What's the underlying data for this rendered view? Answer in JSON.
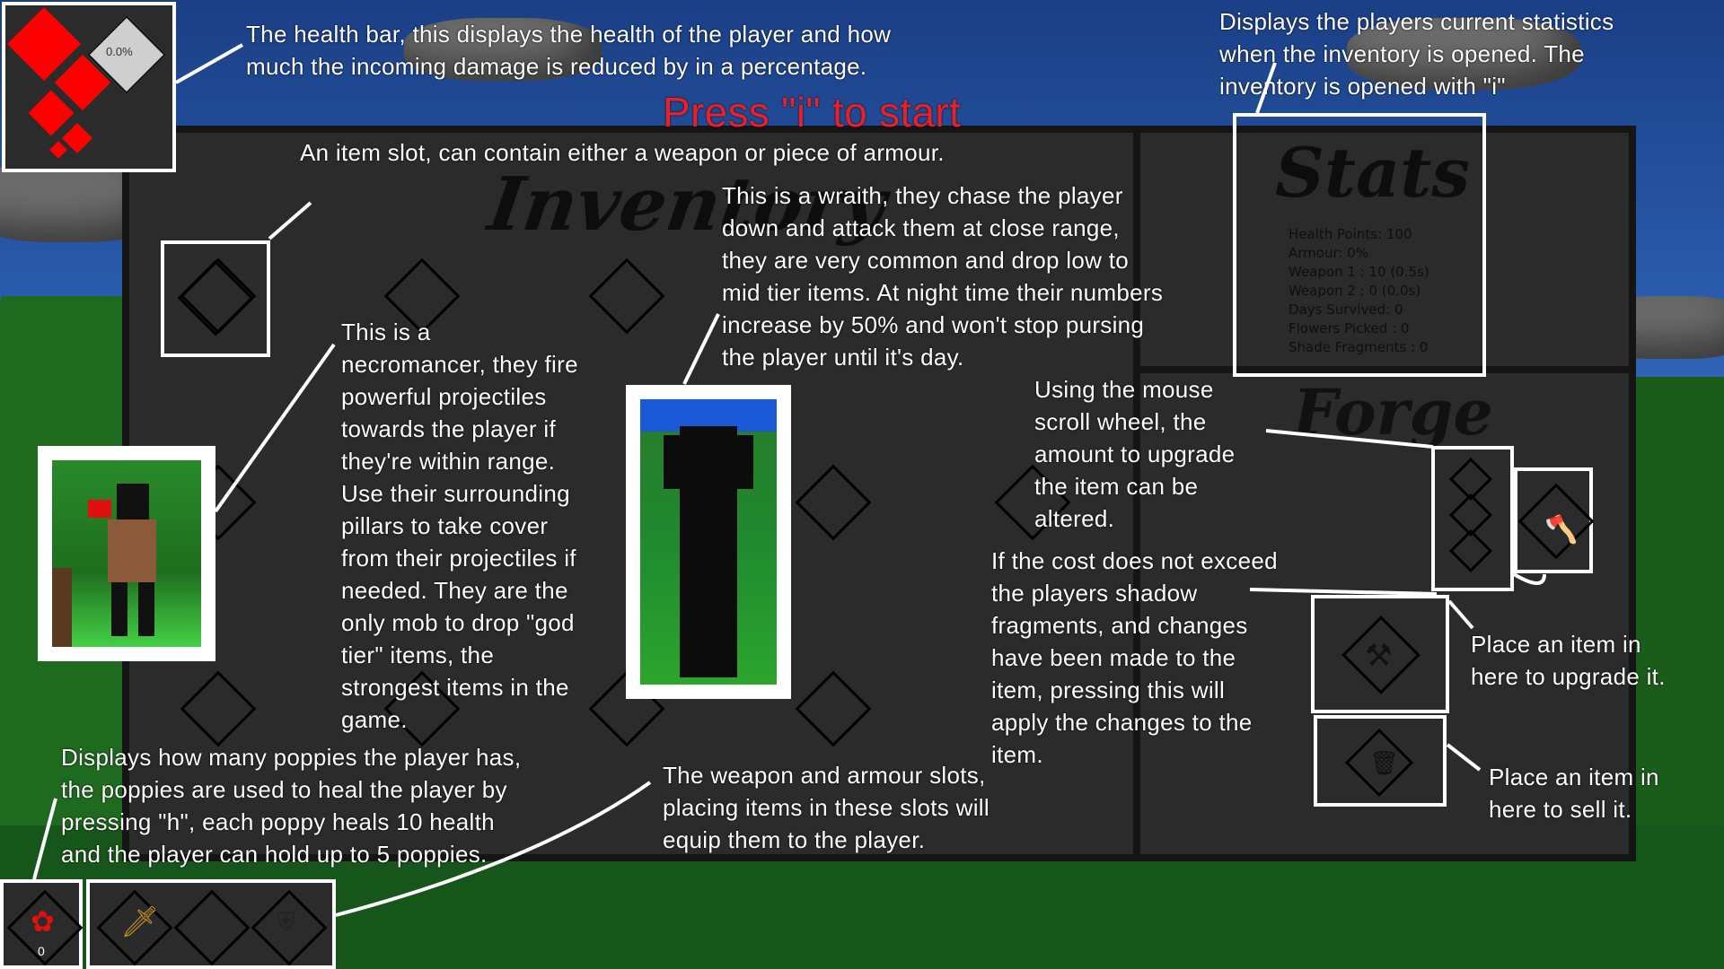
{
  "title": "Press \"i\" to start",
  "inventory_heading": "Inventory",
  "stats_heading": "Stats",
  "forge_heading": "Forge",
  "health_armour_value": "0.0%",
  "poppy_count": "0",
  "stats": [
    "Health Points: 100",
    "Armour: 0%",
    "Weapon 1 : 10 (0.5s)",
    "Weapon 2 : 0 (0.0s)",
    "Days Survived: 0",
    "Flowers Picked : 0",
    "Shade Fragments : 0"
  ],
  "annotations": {
    "health": [
      "The health bar, this displays the health of the player and how",
      "much the incoming damage is reduced by in a percentage."
    ],
    "stats": [
      "Displays the players current statistics",
      "when the inventory is opened. The",
      "inventory is opened with \"i\""
    ],
    "item_slot": [
      "An item slot, can contain either a weapon or piece of armour."
    ],
    "wraith": [
      "This is a wraith, they chase the player",
      "down and attack them at close range,",
      "they are very common and drop low to",
      "mid tier items. At night time their numbers",
      "increase by 50% and won't stop pursing",
      "the player until it's day."
    ],
    "necromancer": [
      "This is a",
      "necromancer, they fire",
      "powerful projectiles",
      "towards the player if",
      "they're within range.",
      "Use their surrounding",
      "pillars to take cover",
      "from their projectiles if",
      "needed. They are the",
      "only mob to drop \"god",
      "tier\" items, the",
      "strongest items in the",
      "game."
    ],
    "scroll": [
      "Using the mouse",
      "scroll wheel, the",
      "amount to upgrade",
      "the item can be",
      "altered."
    ],
    "apply": [
      "If the cost does not exceed",
      "the players shadow",
      "fragments, and changes",
      "have been made to the",
      "item, pressing this will",
      "apply the changes to the",
      "item."
    ],
    "upgrade": [
      "Place an item in",
      "here to upgrade it."
    ],
    "sell": [
      "Place an item in",
      "here to sell it."
    ],
    "poppies": [
      "Displays how many poppies the player has,",
      "the poppies are used to heal the player by",
      "pressing \"h\", each poppy heals 10 health",
      "and the player can hold up to 5 poppies."
    ],
    "equip": [
      "The weapon and armour slots,",
      "placing items in these slots will",
      "equip them to the player."
    ]
  },
  "colors": {
    "health": "#ff0000",
    "title": "#e8202a",
    "panel": "#2b2b2b"
  },
  "icons": [
    "heart-diamond-icon",
    "armour-shield-icon",
    "poppy-icon",
    "sword-icon",
    "shield-icon",
    "axe-icon",
    "anvil-icon",
    "sell-bin-icon"
  ]
}
